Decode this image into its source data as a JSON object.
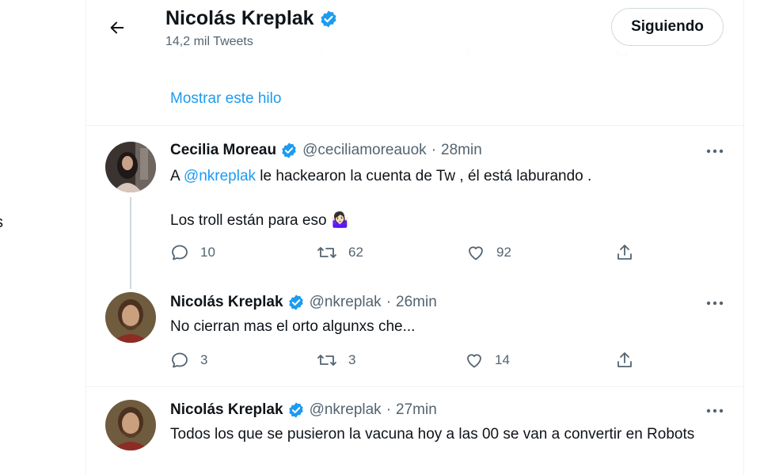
{
  "left_stub": "s",
  "header": {
    "title": "Nicolás Kreplak",
    "subtitle": "14,2 mil Tweets",
    "follow_label": "Siguiendo"
  },
  "show_thread": "Mostrar este hilo",
  "tweets": [
    {
      "name": "Cecilia Moreau",
      "handle": "@ceciliamoreauok",
      "dot": "·",
      "time": "28min",
      "text_prefix": "A ",
      "mention": "@nkreplak",
      "text_suffix": " le hackearon la cuenta de Tw , él está laburando .",
      "text_line2": "Los troll están para eso 🤷🏻‍♀️",
      "replies": "10",
      "retweets": "62",
      "likes": "92"
    },
    {
      "name": "Nicolás Kreplak",
      "handle": "@nkreplak",
      "dot": "·",
      "time": "26min",
      "text": "No cierran mas el orto algunxs che...",
      "replies": "3",
      "retweets": "3",
      "likes": "14"
    },
    {
      "name": "Nicolás Kreplak",
      "handle": "@nkreplak",
      "dot": "·",
      "time": "27min",
      "text": "Todos los que se pusieron la vacuna hoy a las 00 se van a convertir en Robots"
    }
  ],
  "colors": {
    "accent": "#1d9bf0",
    "text": "#0f1419",
    "muted": "#536471",
    "border": "#eff3f4"
  },
  "icons": {
    "back": "arrow-left-icon",
    "verified": "verified-badge-icon",
    "more": "more-icon",
    "reply": "reply-icon",
    "retweet": "retweet-icon",
    "like": "like-icon",
    "share": "share-icon"
  }
}
